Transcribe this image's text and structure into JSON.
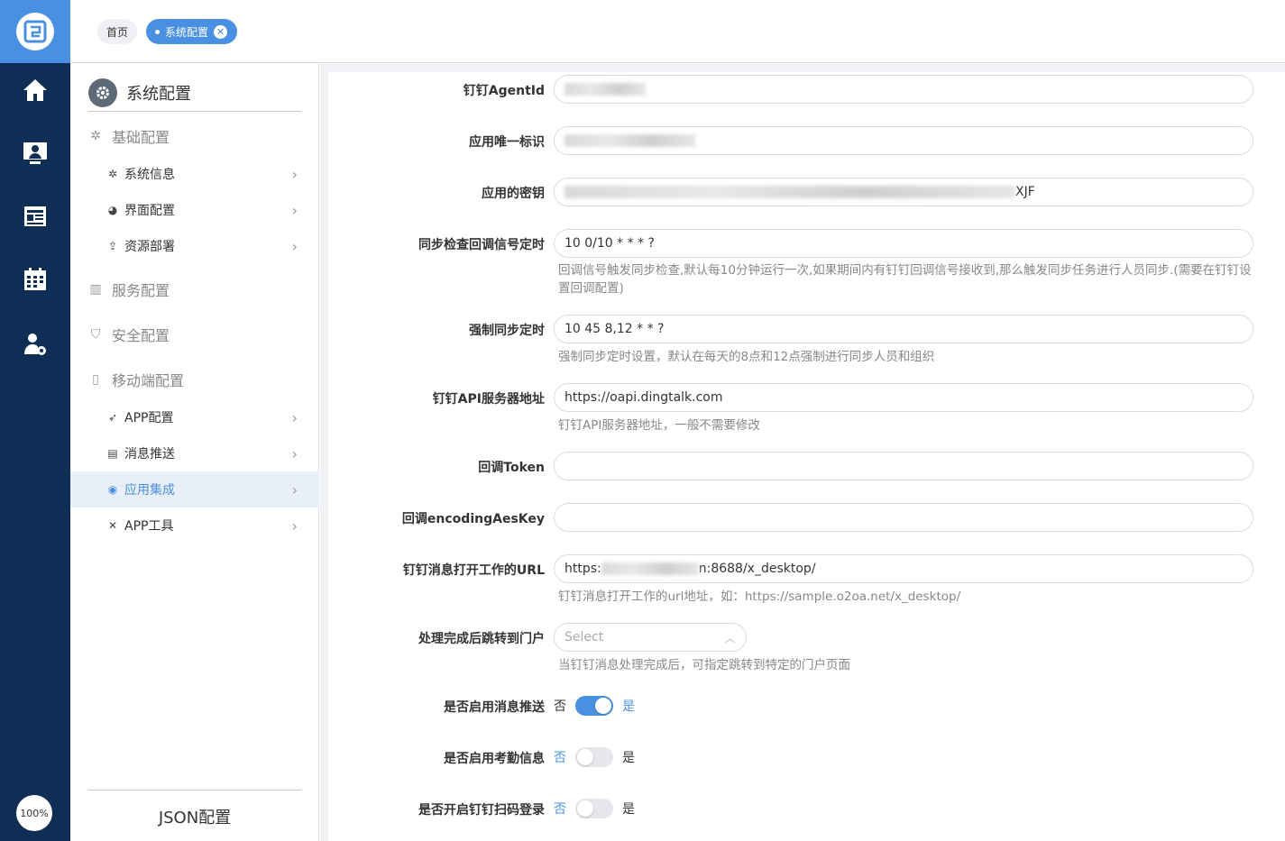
{
  "rail": {
    "logo_icon": "o2oa-logo-icon",
    "icons": [
      "home-icon",
      "monitor-user-icon",
      "news-icon",
      "calendar-icon",
      "user-settings-icon"
    ],
    "zoom": "100%"
  },
  "tabs": [
    {
      "label": "首页"
    },
    {
      "label": "系统配置",
      "active": true
    }
  ],
  "sidebar": {
    "title": "系统配置",
    "groups": {
      "basic": {
        "label": "基础配置",
        "items": [
          "系统信息",
          "界面配置",
          "资源部署"
        ]
      },
      "service": {
        "label": "服务配置"
      },
      "security": {
        "label": "安全配置"
      },
      "mobile": {
        "label": "移动端配置",
        "items": [
          "APP配置",
          "消息推送",
          "应用集成",
          "APP工具"
        ],
        "active": "应用集成"
      }
    },
    "footer": "JSON配置"
  },
  "form": {
    "agentid": {
      "label": "钉钉AgentId",
      "value": ""
    },
    "appkey": {
      "label": "应用唯一标识",
      "value": ""
    },
    "secret": {
      "label": "应用的密钥",
      "value_suffix": "XJF"
    },
    "sync_check": {
      "label": "同步检查回调信号定时",
      "value": "10 0/10 * * * ?",
      "help1": "回调信号触发同步检查,默认每10分钟运行一次,如果期间内有钉钉回调信号接收到,那么触发同步任务进行人员同步.(需要在钉钉设",
      "help2": "置回调配置)"
    },
    "force_sync": {
      "label": "强制同步定时",
      "value": "10 45 8,12 * * ?",
      "help": "强制同步定时设置，默认在每天的8点和12点强制进行同步人员和组织"
    },
    "api_server": {
      "label": "钉钉API服务器地址",
      "value": "https://oapi.dingtalk.com",
      "help": "钉钉API服务器地址，一般不需要修改"
    },
    "token": {
      "label": "回调Token",
      "value": ""
    },
    "aeskey": {
      "label": "回调encodingAesKey",
      "value": ""
    },
    "msg_url": {
      "label": "钉钉消息打开工作的URL",
      "value_prefix": "https:",
      "value_suffix": "n:8688/x_desktop/",
      "help": "钉钉消息打开工作的url地址，如：https://sample.o2oa.net/x_desktop/"
    },
    "portal": {
      "label": "处理完成后跳转到门户",
      "placeholder": "Select",
      "help": "当钉钉消息处理完成后，可指定跳转到特定的门户页面"
    },
    "enable_push": {
      "label": "是否启用消息推送",
      "off": "否",
      "on": "是",
      "state": true
    },
    "enable_attendance": {
      "label": "是否启用考勤信息",
      "off": "否",
      "on": "是",
      "state": false
    },
    "enable_scan": {
      "label": "是否开启钉钉扫码登录",
      "off": "否",
      "on": "是",
      "state": false
    }
  }
}
